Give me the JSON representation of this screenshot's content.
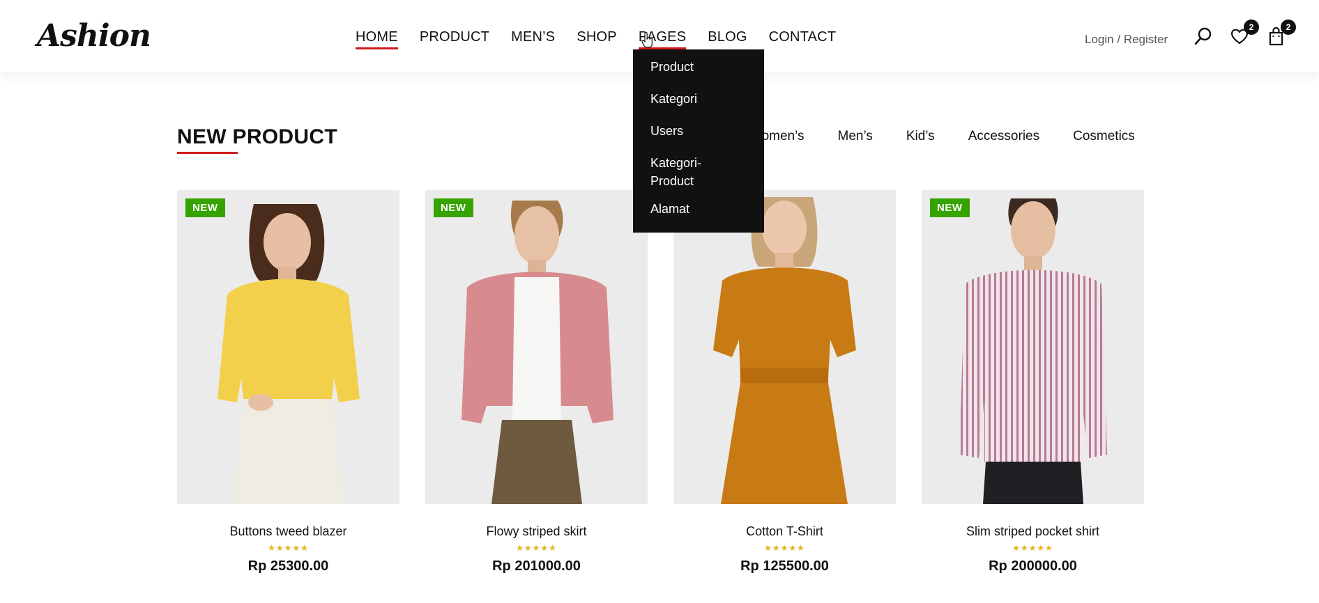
{
  "brand": {
    "logo": "Ashion"
  },
  "nav": {
    "items": [
      {
        "label": "HOME",
        "active": true
      },
      {
        "label": "PRODUCT"
      },
      {
        "label": "MEN’S"
      },
      {
        "label": "SHOP"
      },
      {
        "label": "PAGES",
        "hovered": true
      },
      {
        "label": "BLOG"
      },
      {
        "label": "CONTACT"
      }
    ]
  },
  "header": {
    "login_label": "Login",
    "separator": "/",
    "register_label": "Register",
    "search_icon": "search-icon",
    "wishlist_icon": "heart-icon",
    "wishlist_count": "2",
    "cart_icon": "shopping-bag-icon",
    "cart_count": "2"
  },
  "dropdown": {
    "items": [
      "Product",
      "Kategori",
      "Users",
      "Kategori-\nProduct",
      "Alamat"
    ]
  },
  "section": {
    "title": "NEW PRODUCT",
    "filters": [
      "Women’s",
      "Men’s",
      "Kid’s",
      "Accessories",
      "Cosmetics"
    ]
  },
  "products": [
    {
      "label": "NEW",
      "name": "Buttons tweed blazer",
      "rating": 5,
      "stars": "★★★★★",
      "price": "Rp 25300.00"
    },
    {
      "label": "NEW",
      "name": "Flowy striped skirt",
      "rating": 5,
      "stars": "★★★★★",
      "price": "Rp 201000.00"
    },
    {
      "label": "",
      "name": "Cotton T-Shirt",
      "rating": 5,
      "stars": "★★★★★",
      "price": "Rp 125500.00"
    },
    {
      "label": "NEW",
      "name": "Slim striped pocket shirt",
      "rating": 5,
      "stars": "★★★★★",
      "price": "Rp 200000.00"
    }
  ],
  "colors": {
    "accent_red": "#d01a1a",
    "new_badge_green": "#36a300",
    "star_gold": "#e3b41b",
    "dropdown_bg": "#111111"
  }
}
